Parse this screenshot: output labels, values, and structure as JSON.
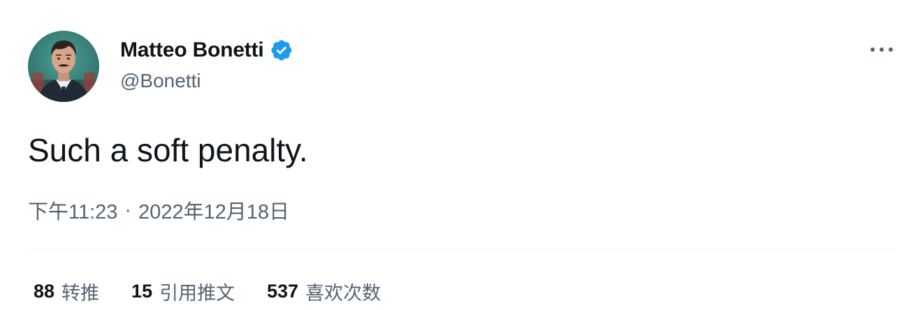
{
  "author": {
    "display_name": "Matteo Bonetti",
    "handle": "@Bonetti",
    "verified": true,
    "verified_color": "#1d9bf0"
  },
  "tweet": {
    "text": "Such a soft penalty.",
    "time": "下午11:23",
    "separator": "·",
    "date": "2022年12月18日"
  },
  "stats": {
    "retweets": {
      "count": "88",
      "label": "转推"
    },
    "quotes": {
      "count": "15",
      "label": "引用推文"
    },
    "likes": {
      "count": "537",
      "label": "喜欢次数"
    }
  },
  "icons": {
    "more": "more-horizontal-icon",
    "verified": "verified-badge-icon"
  }
}
